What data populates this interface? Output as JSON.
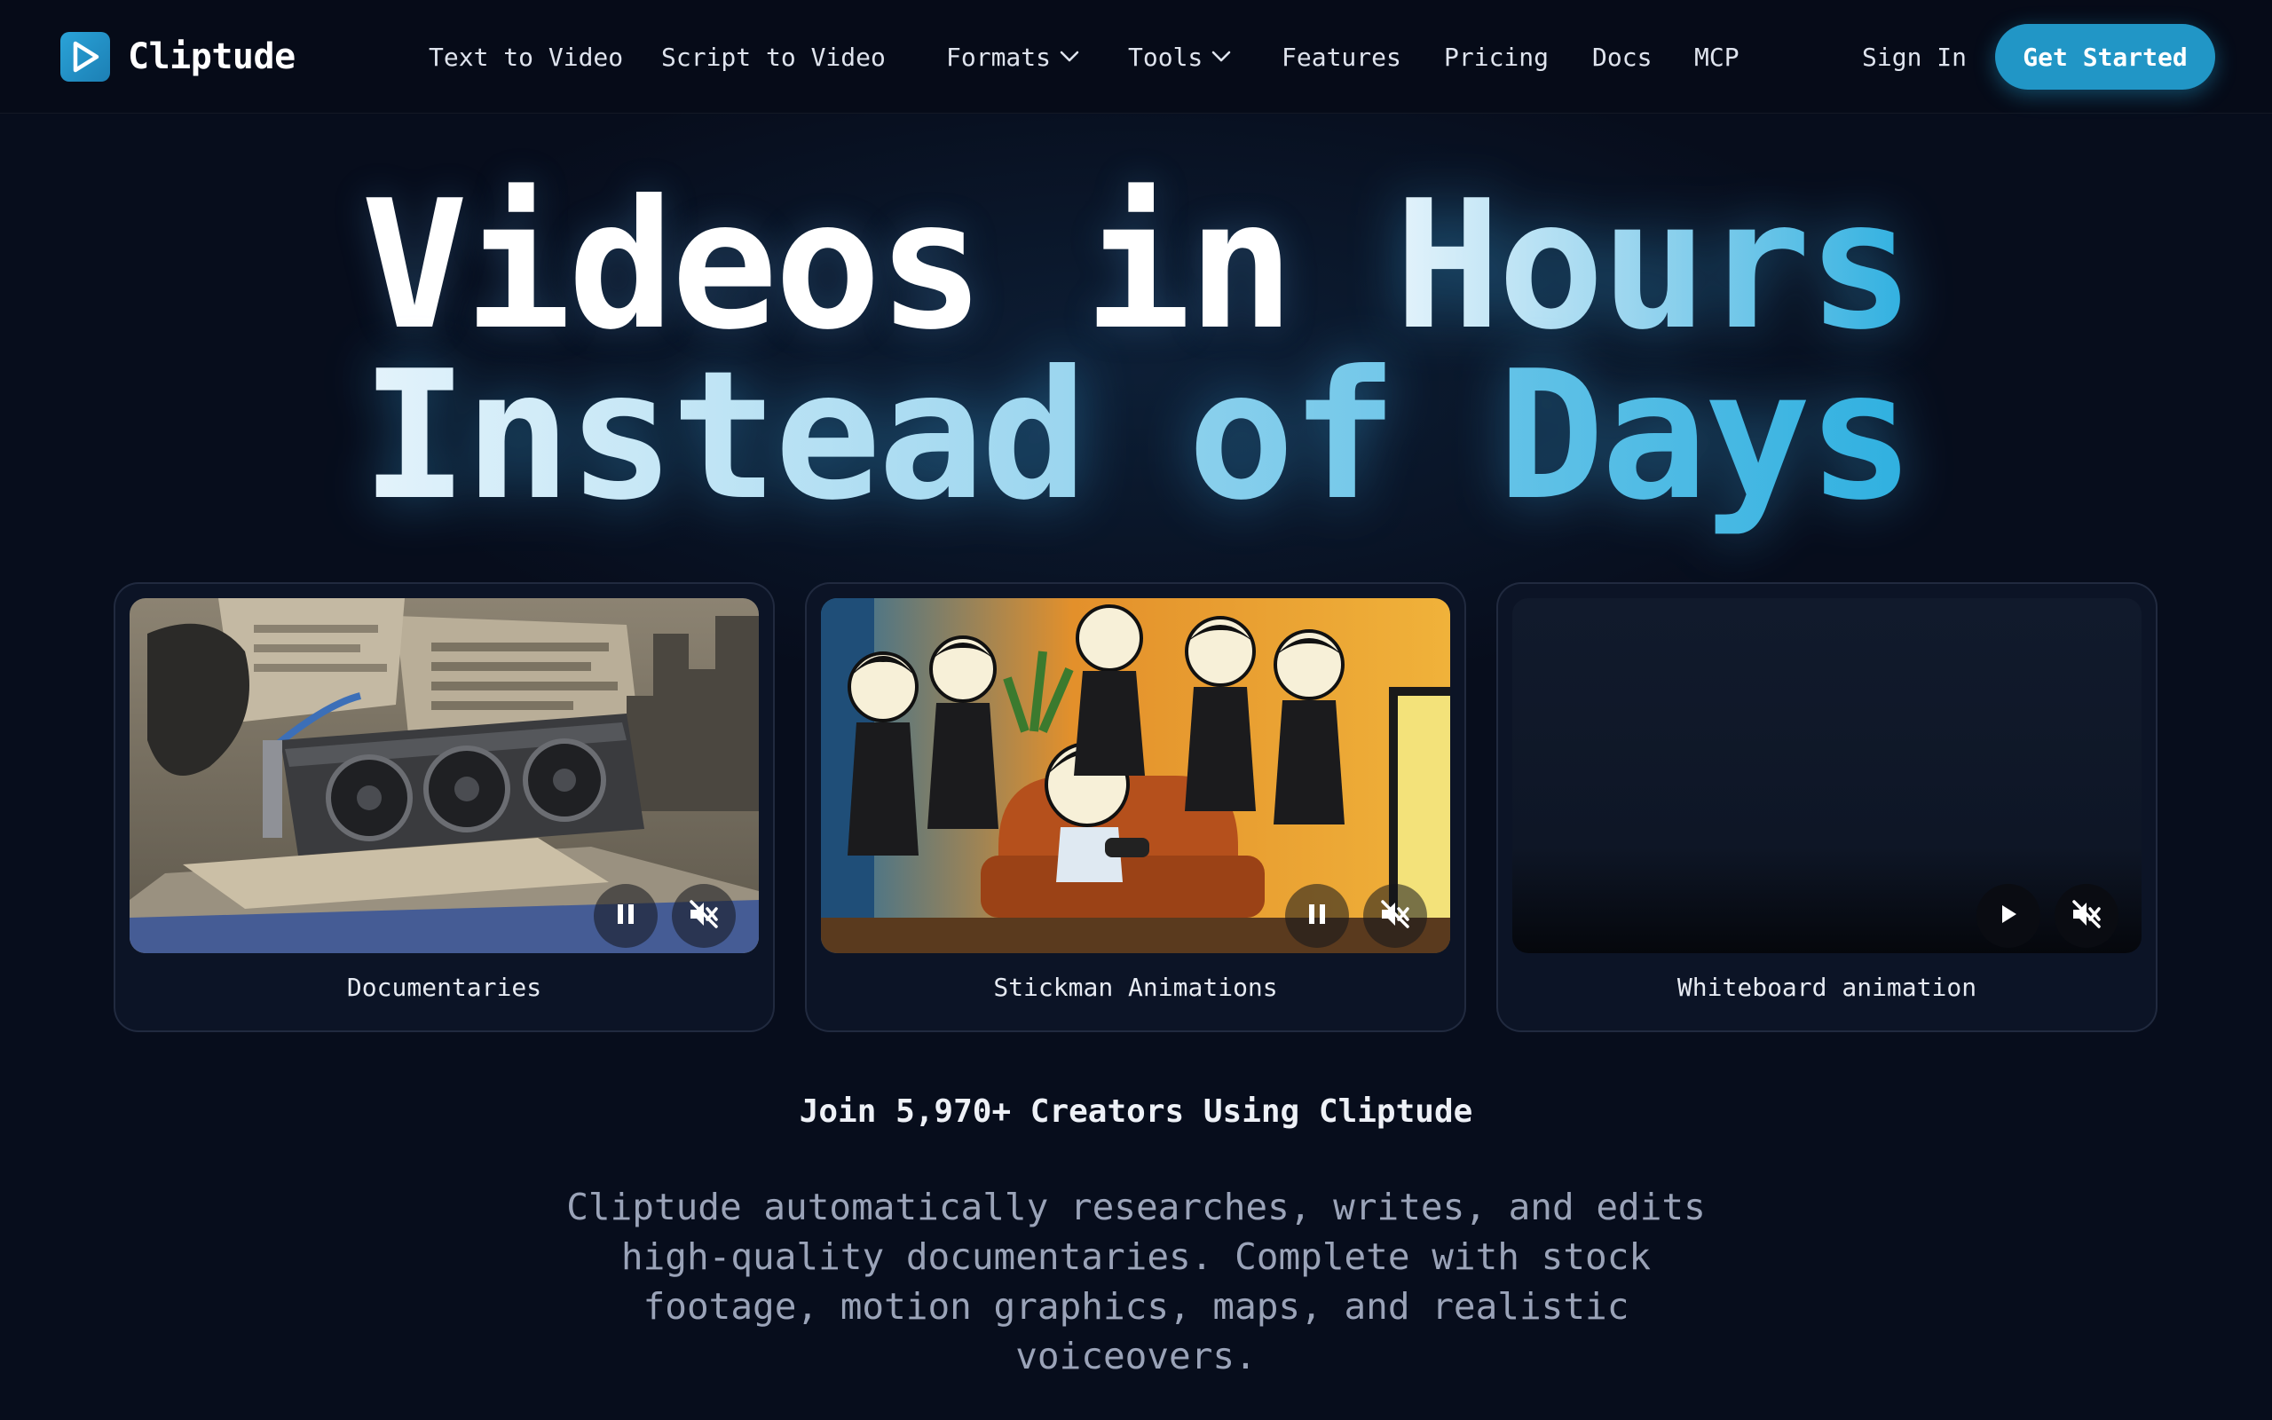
{
  "brand": {
    "name": "Cliptude",
    "icon": "play-icon",
    "accent": "#2196c6"
  },
  "nav": {
    "links": [
      {
        "label": "Text to Video",
        "dropdown": false
      },
      {
        "label": "Script to Video",
        "dropdown": false
      },
      {
        "label": "Formats",
        "dropdown": true
      },
      {
        "label": "Tools",
        "dropdown": true
      },
      {
        "label": "Features",
        "dropdown": false
      },
      {
        "label": "Pricing",
        "dropdown": false
      },
      {
        "label": "Docs",
        "dropdown": false
      },
      {
        "label": "MCP",
        "dropdown": false
      }
    ],
    "sign_in": "Sign In",
    "cta": "Get Started"
  },
  "hero": {
    "line1_white": "Videos in",
    "line1_accent": "Hours",
    "line2": "Instead of Days"
  },
  "cards": [
    {
      "caption": "Documentaries",
      "playing": true,
      "muted": true
    },
    {
      "caption": "Stickman Animations",
      "playing": true,
      "muted": true
    },
    {
      "caption": "Whiteboard animation",
      "playing": false,
      "muted": true
    }
  ],
  "social_proof": "Join 5,970+ Creators Using Cliptude",
  "description": "Cliptude automatically researches, writes, and edits high-quality documentaries. Complete with stock footage, motion graphics, maps, and realistic voiceovers."
}
